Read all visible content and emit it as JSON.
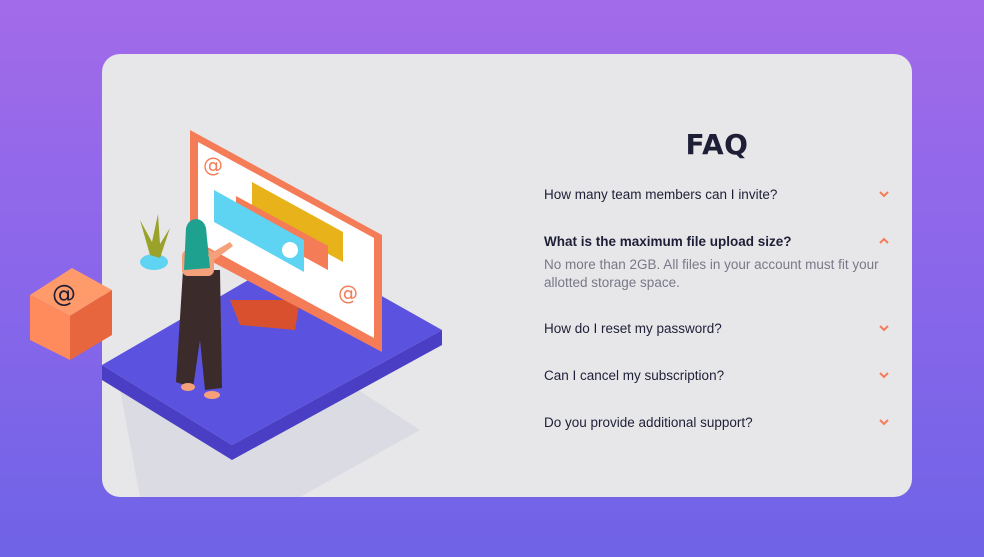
{
  "title": "FAQ",
  "items": [
    {
      "question": "How many team members can I invite?",
      "expanded": false,
      "answer": ""
    },
    {
      "question": "What is the maximum file upload size?",
      "expanded": true,
      "answer": "No more than 2GB. All files in your account must fit your allotted storage space."
    },
    {
      "question": "How do I reset my password?",
      "expanded": false,
      "answer": ""
    },
    {
      "question": "Can I cancel my subscription?",
      "expanded": false,
      "answer": ""
    },
    {
      "question": "Do you provide additional support?",
      "expanded": false,
      "answer": ""
    }
  ],
  "colors": {
    "background_top": "#a26be9",
    "background_bottom": "#6f63e6",
    "card": "#e7e7ea",
    "accent": "#f47c57",
    "text_dark": "#1e1f36",
    "text_muted": "#787887"
  },
  "icons": {
    "chevron_collapsed": "chevron-down-icon",
    "chevron_expanded": "chevron-up-icon",
    "box": "at-sign-box-icon"
  }
}
